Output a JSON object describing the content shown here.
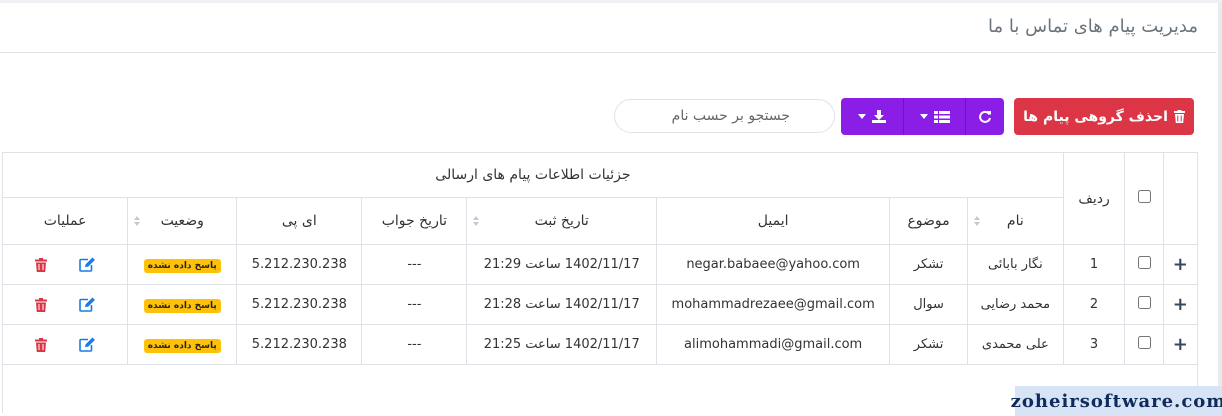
{
  "header": {
    "title": "مدیریت پیام های تماس با ما"
  },
  "toolbar": {
    "delete_label": "احذف گروهی پیام ها",
    "search_placeholder": "جستجو بر حسب نام",
    "refresh_icon": "refresh-icon",
    "columns_icon": "list-icon",
    "export_icon": "download-icon",
    "accent_color": "#8b1ee6",
    "danger_color": "#dc3545"
  },
  "table": {
    "group_header": "جزئیات اطلاعات پیام های ارسالی",
    "headers": {
      "row": "ردیف",
      "name": "نام",
      "subject": "موضوع",
      "email": "ایمیل",
      "registered": "تاریخ ثبت",
      "answered": "تاریخ جواب",
      "ip": "ای پی",
      "status": "وضعیت",
      "actions": "عملیات"
    },
    "rows": [
      {
        "index": "1",
        "name": "نگار بابائی",
        "subject": "تشکر",
        "email": "negar.babaee@yahoo.com",
        "registered": "1402/11/17 ساعت 21:29",
        "answered": "---",
        "ip": "5.212.230.238",
        "status": "پاسخ داده نشده"
      },
      {
        "index": "2",
        "name": "محمد رضایی",
        "subject": "سوال",
        "email": "mohammadrezaee@gmail.com",
        "registered": "1402/11/17 ساعت 21:28",
        "answered": "---",
        "ip": "5.212.230.238",
        "status": "پاسخ داده نشده"
      },
      {
        "index": "3",
        "name": "علی محمدی",
        "subject": "تشکر",
        "email": "alimohammadi@gmail.com",
        "registered": "1402/11/17 ساعت 21:25",
        "answered": "---",
        "ip": "5.212.230.238",
        "status": "پاسخ داده نشده"
      }
    ],
    "status_color": "#ffc107"
  },
  "watermark": "zoheirsoftware.com"
}
